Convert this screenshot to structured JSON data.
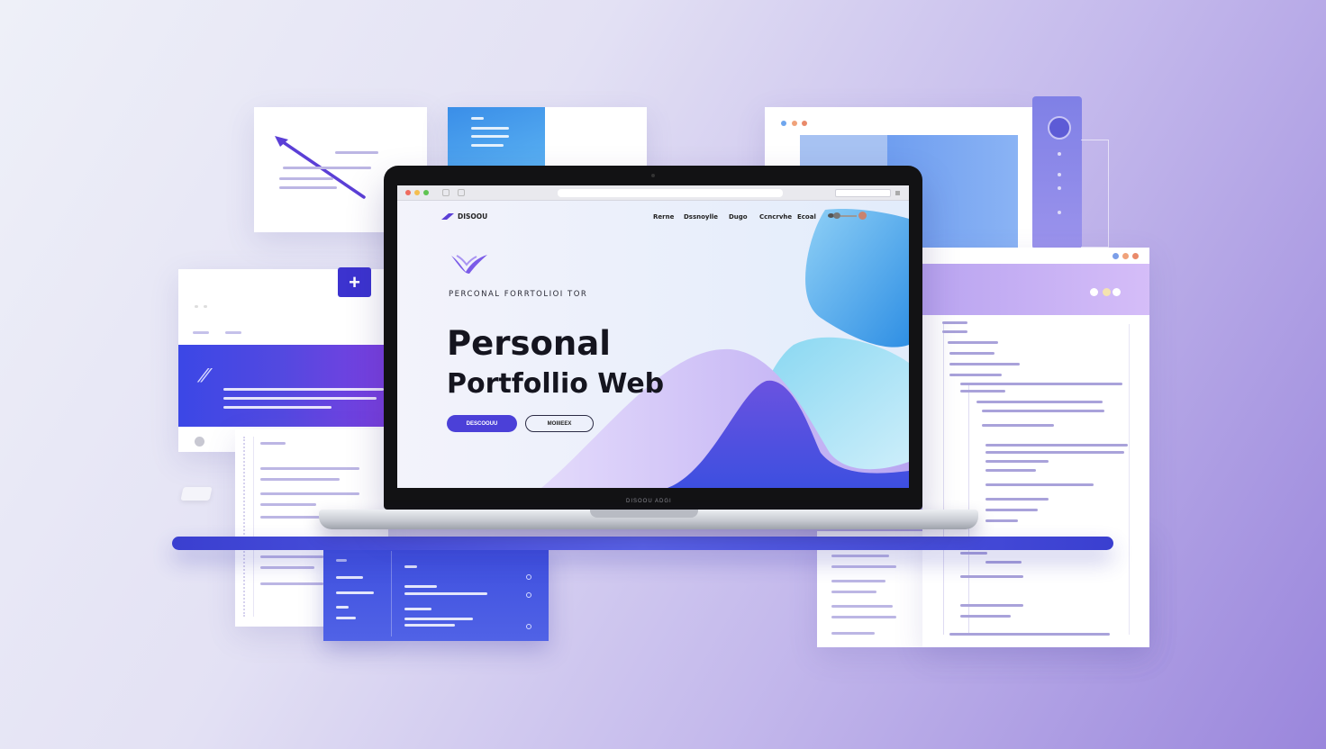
{
  "site": {
    "logo_text": "DISOOU",
    "nav": [
      "Rerne",
      "Dssnoylle",
      "Dugo",
      "Ccncrvhe",
      "Ecoal"
    ],
    "hero_kicker": "PERCONAL FORRTOLIOI TOR",
    "hero_title": "Personal",
    "hero_subtitle": "Portfollio Web",
    "primary_button": "DESCOOUU",
    "secondary_button": "MOIIIEEX"
  },
  "laptop": {
    "base_label": "DISOOU ADGI"
  },
  "left_panel": {
    "add_label": "+"
  },
  "colors": {
    "accent": "#4b40d8",
    "shelf": "#3a3fd0",
    "panel_blue": "#3f48e0",
    "light_purple": "#c9b7f5"
  }
}
